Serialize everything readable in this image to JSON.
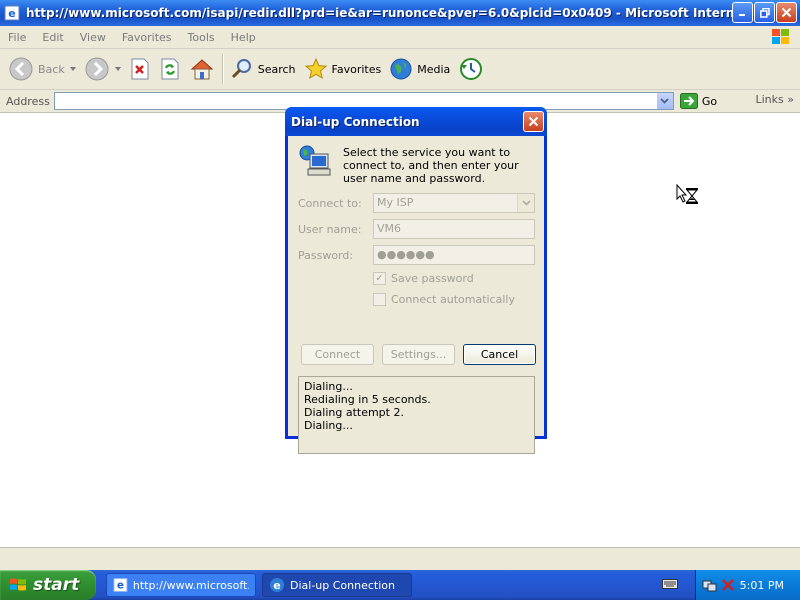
{
  "browser": {
    "title": "http://www.microsoft.com/isapi/redir.dll?prd=ie&ar=runonce&pver=6.0&plcid=0x0409 - Microsoft Internet Ex...",
    "menu": [
      "File",
      "Edit",
      "View",
      "Favorites",
      "Tools",
      "Help"
    ],
    "toolbar": {
      "back": "Back",
      "search": "Search",
      "favorites": "Favorites",
      "media": "Media"
    },
    "address": {
      "label": "Address",
      "value": "",
      "go": "Go",
      "links": "Links"
    }
  },
  "dialog": {
    "title": "Dial-up Connection",
    "instructions": "Select the service you want to connect to, and then enter your user name and password.",
    "connect_to_label": "Connect to:",
    "connect_to_value": "My ISP",
    "username_label": "User name:",
    "username_value": "VM6",
    "password_label": "Password:",
    "password_value": "●●●●●●",
    "save_password": {
      "label": "Save password",
      "checked": true
    },
    "connect_auto": {
      "label": "Connect automatically",
      "checked": false
    },
    "buttons": {
      "connect": "Connect",
      "settings": "Settings...",
      "cancel": "Cancel"
    },
    "status_lines": [
      "Dialing...",
      "Redialing in 5 seconds.",
      "Dialing attempt 2.",
      "Dialing..."
    ]
  },
  "taskbar": {
    "start": "start",
    "tasks": [
      "http://www.microsoft...",
      "Dial-up Connection"
    ],
    "clock": "5:01 PM"
  }
}
